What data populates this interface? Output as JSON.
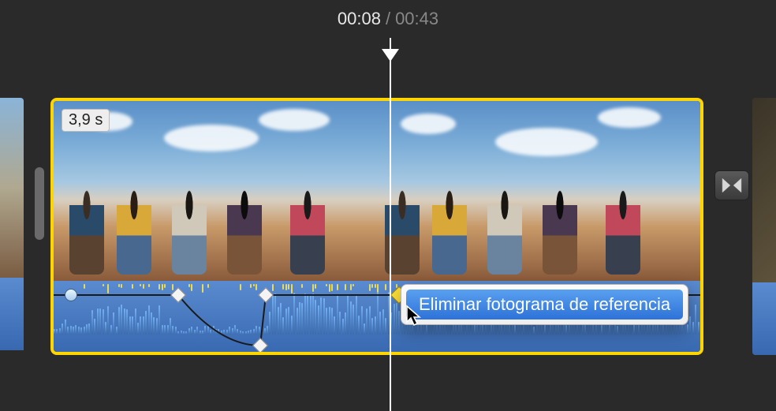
{
  "timecode": {
    "current": "00:08",
    "separator": "/",
    "total": "00:43"
  },
  "clip": {
    "duration_label": "3,9 s"
  },
  "context_menu": {
    "item_delete_keyframe": "Eliminar fotograma de referencia"
  },
  "icons": {
    "transition": "bowtie-transition-icon"
  },
  "colors": {
    "selection": "#ffd500",
    "menu_highlight": "#2d72d8",
    "audio_track": "#3868b0"
  }
}
